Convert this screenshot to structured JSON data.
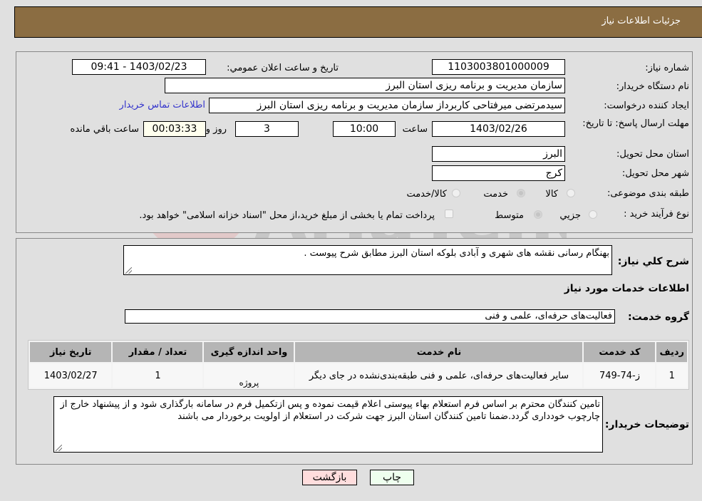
{
  "header": {
    "title": "جزئیات اطلاعات نیاز"
  },
  "info": {
    "need_number_label": "شماره نیاز:",
    "need_number": "1103003801000009",
    "announce_label": "تاریخ و ساعت اعلان عمومي:",
    "announce_value": "1403/02/23 - 09:41",
    "buyer_org_label": "نام دستگاه خريدار:",
    "buyer_org": "سازمان مدیریت و برنامه ریزی استان البرز",
    "creator_label": "ایجاد کننده درخواست:",
    "creator": "سیدمرتضی میرفتاحی کاربرداز سازمان مدیریت و برنامه ریزی استان البرز",
    "contact_link": "اطلاعات تماس خریدار",
    "deadline_label": "مهلت ارسال پاسخ: تا تاریخ:",
    "deadline_date": "1403/02/26",
    "time_label": "ساعت",
    "deadline_time": "10:00",
    "days_value": "3",
    "days_label": "روز و",
    "remaining_time": "00:03:33",
    "remaining_label": "ساعت باقي مانده",
    "province_label": "استان محل تحویل:",
    "province": "البرز",
    "city_label": "شهر محل تحویل:",
    "city": "کرج",
    "category_label": "طبقه بندی موضوعی:",
    "category_options": [
      {
        "label": "کالا",
        "checked": false
      },
      {
        "label": "خدمت",
        "checked": true
      },
      {
        "label": "کالا/خدمت",
        "checked": false
      }
    ],
    "purchase_type_label": "نوع فرآیند خرید :",
    "purchase_options": [
      {
        "label": "جزيي",
        "checked": false
      },
      {
        "label": "متوسط",
        "checked": true
      }
    ],
    "treasury_note": "پرداخت تمام یا بخشی از مبلغ خرید،از محل \"اسناد خزانه اسلامی\" خواهد بود."
  },
  "details": {
    "summary_label": "شرح کلي نياز:",
    "summary": "بهنگام رسانی نقشه های شهری و آبادی بلوکه استان البرز مطابق شرح پیوست .",
    "services_heading": "اطلاعات خدمات مورد نياز",
    "service_group_label": "گروه خدمت:",
    "service_group": "فعالیت‌های حرفه‌ای، علمی و فنی",
    "table": {
      "headers": [
        "ردیف",
        "کد خدمت",
        "نام خدمت",
        "واحد اندازه گیری",
        "تعداد / مقدار",
        "تاریخ نیاز"
      ],
      "rows": [
        [
          "1",
          "ز-74-749",
          "سایر فعالیت‌های حرفه‌ای، علمی و فنی طبقه‌بندی‌نشده در جای دیگر",
          "پروژه",
          "1",
          "1403/02/27"
        ]
      ]
    },
    "buyer_notes_label": "توضیحات خریدار:",
    "buyer_notes": "تامین کنندگان محترم بر اساس فرم استعلام بهاء پیوستی اعلام قیمت نموده و پس ازتکمیل فرم در سامانه بارگذاری شود و از پیشنهاد خارج از چارچوب خودداری گردد.ضمنا  تامین کنندگان استان البرز جهت شرکت در استعلام از اولویت برخوردار می باشند"
  },
  "buttons": {
    "print": "چاپ",
    "back": "بازگشت"
  },
  "watermark": "AriaTender.neT",
  "colors": {
    "header_bg": "#8b6d42",
    "link": "#3333cc",
    "print_bg": "#eeffee",
    "back_bg": "#ffdddd",
    "remaining_bg": "#ffffee"
  }
}
